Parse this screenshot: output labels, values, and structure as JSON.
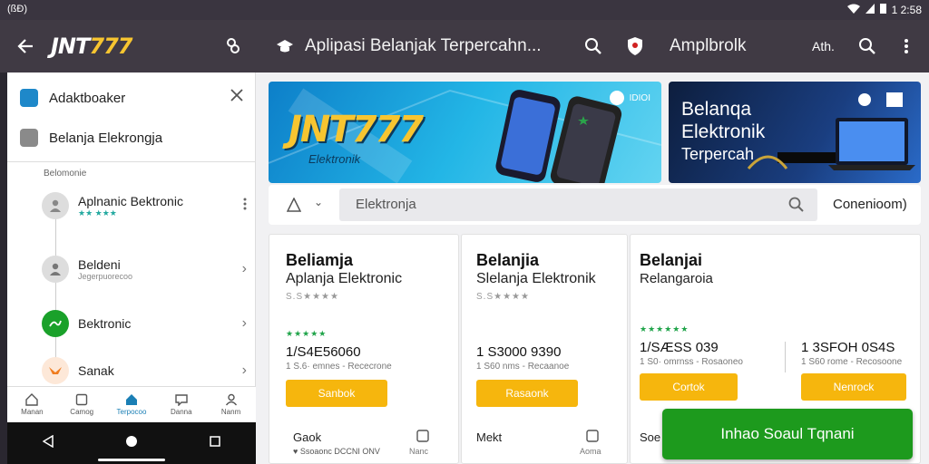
{
  "statusbar": {
    "left": "(ßÐ)",
    "time": "1 2:58"
  },
  "topbar": {
    "logo_a": "JNT",
    "logo_b": "777",
    "title": "Aplipasi Belanjak Terpercahn...",
    "account": "Amplbrolk",
    "aa": "Ath."
  },
  "sidebar": {
    "header1": "Adaktboaker",
    "header2": "Belanja Elekrongja",
    "section": "Belomonie",
    "items": [
      {
        "label": "Aplnanic Bektronic",
        "sub": "★★ ★★★"
      },
      {
        "label": "Beldeni",
        "sub": "Jegerpuorecoo"
      },
      {
        "label": "Bektronic",
        "sub": ""
      },
      {
        "label": "Sanak",
        "sub": ""
      }
    ],
    "colors": {
      "accent_green": "#1aa12a",
      "accent_orange": "#f07d20",
      "header_icon": "#1e88c9"
    }
  },
  "bottomnav": [
    "Manan",
    "Camog",
    "Terpocoo",
    "Danna",
    "Nanm"
  ],
  "banner1": {
    "brand": "JNT777",
    "caption": "Elektronik",
    "badge": "IDIOI"
  },
  "banner2": {
    "line1": "Belanqa",
    "line2": "Elektronik",
    "line3": "Terpercah"
  },
  "search": {
    "placeholder": "Elektronja",
    "right_label": "Conenioom)"
  },
  "cards": [
    {
      "title": "Beliamja",
      "subtitle": "Aplanja Elektronic",
      "stars": "S.S★★★★",
      "stars2": "★★★★★",
      "price": "1/S4E56060",
      "meta": "1 S.6· emnes - Rececrone",
      "button": "Sanbok",
      "foot": "Gaok",
      "footsub": "♥ Ssoaonc DCCNI ONV",
      "footsub2": "Nanc"
    },
    {
      "title": "Belanjia",
      "subtitle": "Slelanja Elektronik",
      "stars": "S.S★★★★",
      "price": "1 S3000 9390",
      "meta": "1 S60 nms - Recaanoe",
      "button": "Rasaonk",
      "foot": "Mekt",
      "footsub": "",
      "footsub2": "Aoma"
    },
    {
      "title": "Belanjai",
      "subtitle": "Relangaroia",
      "stars2": "★★★★★★",
      "price": "1/SÆSS 039",
      "meta": "1 S0· omrnss - Rosaoneo",
      "button": "Cortok",
      "price2": "1 3SFOH 0S4S",
      "meta2": "1 S60 rome - Recosoone",
      "button2": "Nenrock",
      "foot": "Soe"
    }
  ],
  "cart_button": "Inhao Soaul Tqnani",
  "colors": {
    "topbar": "#403a44",
    "button_yellow": "#f6b60d",
    "cart_green": "#1d9a1d"
  }
}
